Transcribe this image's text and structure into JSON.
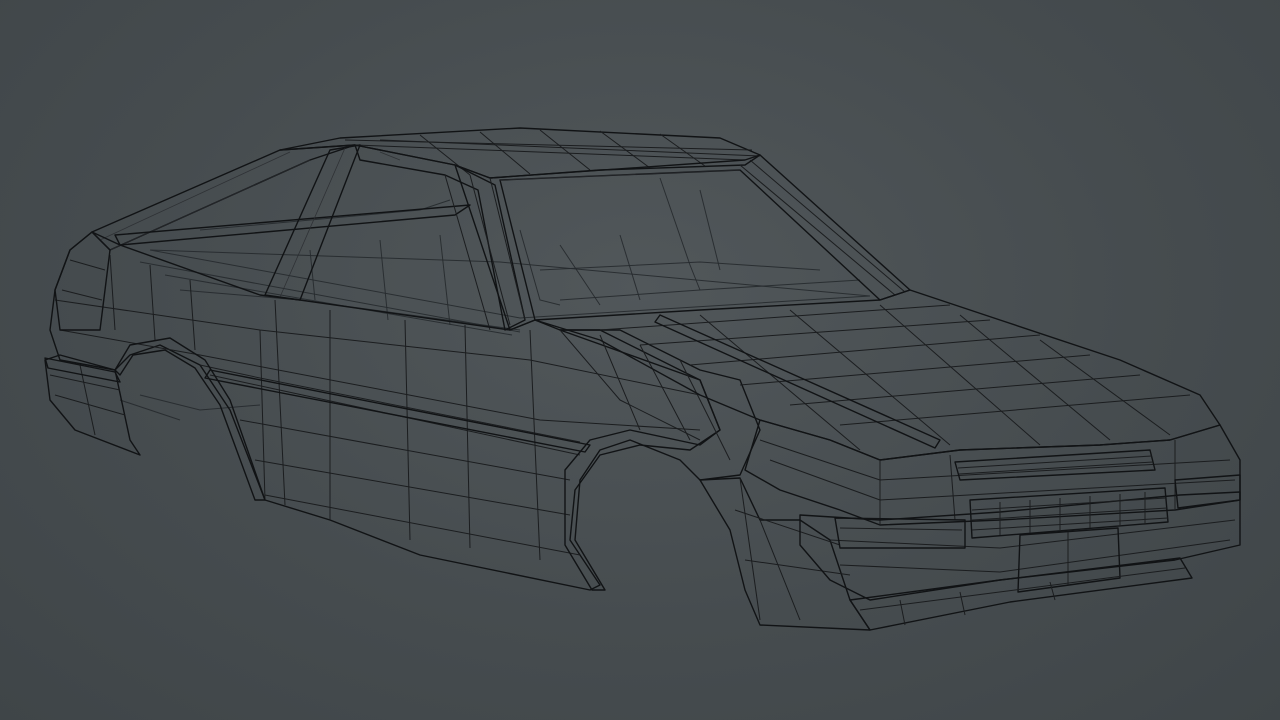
{
  "viewport": {
    "background_color": "#474d50",
    "shading": "normal-map"
  },
  "model": {
    "colors": {
      "side": "#e763c9",
      "side_light": "#f0a8d8",
      "top": "#58e39a",
      "top_light": "#bff5d0",
      "front": "#3fd6c9",
      "front_dark": "#3a6fe6",
      "bottom": "#9b3fe0",
      "wire": "#1b1d1f"
    },
    "display": "wireframe-on-shaded"
  }
}
